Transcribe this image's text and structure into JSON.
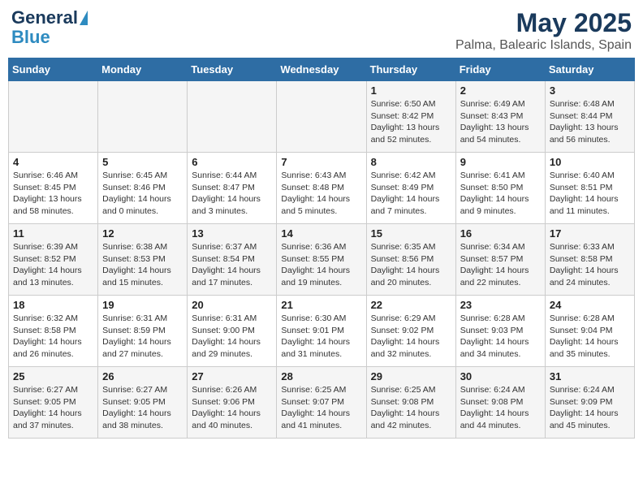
{
  "header": {
    "logo_line1": "General",
    "logo_line2": "Blue",
    "title": "May 2025",
    "subtitle": "Palma, Balearic Islands, Spain"
  },
  "days_of_week": [
    "Sunday",
    "Monday",
    "Tuesday",
    "Wednesday",
    "Thursday",
    "Friday",
    "Saturday"
  ],
  "weeks": [
    [
      {
        "day": "",
        "sunrise": "",
        "sunset": "",
        "daylight": ""
      },
      {
        "day": "",
        "sunrise": "",
        "sunset": "",
        "daylight": ""
      },
      {
        "day": "",
        "sunrise": "",
        "sunset": "",
        "daylight": ""
      },
      {
        "day": "",
        "sunrise": "",
        "sunset": "",
        "daylight": ""
      },
      {
        "day": "1",
        "sunrise": "Sunrise: 6:50 AM",
        "sunset": "Sunset: 8:42 PM",
        "daylight": "Daylight: 13 hours and 52 minutes."
      },
      {
        "day": "2",
        "sunrise": "Sunrise: 6:49 AM",
        "sunset": "Sunset: 8:43 PM",
        "daylight": "Daylight: 13 hours and 54 minutes."
      },
      {
        "day": "3",
        "sunrise": "Sunrise: 6:48 AM",
        "sunset": "Sunset: 8:44 PM",
        "daylight": "Daylight: 13 hours and 56 minutes."
      }
    ],
    [
      {
        "day": "4",
        "sunrise": "Sunrise: 6:46 AM",
        "sunset": "Sunset: 8:45 PM",
        "daylight": "Daylight: 13 hours and 58 minutes."
      },
      {
        "day": "5",
        "sunrise": "Sunrise: 6:45 AM",
        "sunset": "Sunset: 8:46 PM",
        "daylight": "Daylight: 14 hours and 0 minutes."
      },
      {
        "day": "6",
        "sunrise": "Sunrise: 6:44 AM",
        "sunset": "Sunset: 8:47 PM",
        "daylight": "Daylight: 14 hours and 3 minutes."
      },
      {
        "day": "7",
        "sunrise": "Sunrise: 6:43 AM",
        "sunset": "Sunset: 8:48 PM",
        "daylight": "Daylight: 14 hours and 5 minutes."
      },
      {
        "day": "8",
        "sunrise": "Sunrise: 6:42 AM",
        "sunset": "Sunset: 8:49 PM",
        "daylight": "Daylight: 14 hours and 7 minutes."
      },
      {
        "day": "9",
        "sunrise": "Sunrise: 6:41 AM",
        "sunset": "Sunset: 8:50 PM",
        "daylight": "Daylight: 14 hours and 9 minutes."
      },
      {
        "day": "10",
        "sunrise": "Sunrise: 6:40 AM",
        "sunset": "Sunset: 8:51 PM",
        "daylight": "Daylight: 14 hours and 11 minutes."
      }
    ],
    [
      {
        "day": "11",
        "sunrise": "Sunrise: 6:39 AM",
        "sunset": "Sunset: 8:52 PM",
        "daylight": "Daylight: 14 hours and 13 minutes."
      },
      {
        "day": "12",
        "sunrise": "Sunrise: 6:38 AM",
        "sunset": "Sunset: 8:53 PM",
        "daylight": "Daylight: 14 hours and 15 minutes."
      },
      {
        "day": "13",
        "sunrise": "Sunrise: 6:37 AM",
        "sunset": "Sunset: 8:54 PM",
        "daylight": "Daylight: 14 hours and 17 minutes."
      },
      {
        "day": "14",
        "sunrise": "Sunrise: 6:36 AM",
        "sunset": "Sunset: 8:55 PM",
        "daylight": "Daylight: 14 hours and 19 minutes."
      },
      {
        "day": "15",
        "sunrise": "Sunrise: 6:35 AM",
        "sunset": "Sunset: 8:56 PM",
        "daylight": "Daylight: 14 hours and 20 minutes."
      },
      {
        "day": "16",
        "sunrise": "Sunrise: 6:34 AM",
        "sunset": "Sunset: 8:57 PM",
        "daylight": "Daylight: 14 hours and 22 minutes."
      },
      {
        "day": "17",
        "sunrise": "Sunrise: 6:33 AM",
        "sunset": "Sunset: 8:58 PM",
        "daylight": "Daylight: 14 hours and 24 minutes."
      }
    ],
    [
      {
        "day": "18",
        "sunrise": "Sunrise: 6:32 AM",
        "sunset": "Sunset: 8:58 PM",
        "daylight": "Daylight: 14 hours and 26 minutes."
      },
      {
        "day": "19",
        "sunrise": "Sunrise: 6:31 AM",
        "sunset": "Sunset: 8:59 PM",
        "daylight": "Daylight: 14 hours and 27 minutes."
      },
      {
        "day": "20",
        "sunrise": "Sunrise: 6:31 AM",
        "sunset": "Sunset: 9:00 PM",
        "daylight": "Daylight: 14 hours and 29 minutes."
      },
      {
        "day": "21",
        "sunrise": "Sunrise: 6:30 AM",
        "sunset": "Sunset: 9:01 PM",
        "daylight": "Daylight: 14 hours and 31 minutes."
      },
      {
        "day": "22",
        "sunrise": "Sunrise: 6:29 AM",
        "sunset": "Sunset: 9:02 PM",
        "daylight": "Daylight: 14 hours and 32 minutes."
      },
      {
        "day": "23",
        "sunrise": "Sunrise: 6:28 AM",
        "sunset": "Sunset: 9:03 PM",
        "daylight": "Daylight: 14 hours and 34 minutes."
      },
      {
        "day": "24",
        "sunrise": "Sunrise: 6:28 AM",
        "sunset": "Sunset: 9:04 PM",
        "daylight": "Daylight: 14 hours and 35 minutes."
      }
    ],
    [
      {
        "day": "25",
        "sunrise": "Sunrise: 6:27 AM",
        "sunset": "Sunset: 9:05 PM",
        "daylight": "Daylight: 14 hours and 37 minutes."
      },
      {
        "day": "26",
        "sunrise": "Sunrise: 6:27 AM",
        "sunset": "Sunset: 9:05 PM",
        "daylight": "Daylight: 14 hours and 38 minutes."
      },
      {
        "day": "27",
        "sunrise": "Sunrise: 6:26 AM",
        "sunset": "Sunset: 9:06 PM",
        "daylight": "Daylight: 14 hours and 40 minutes."
      },
      {
        "day": "28",
        "sunrise": "Sunrise: 6:25 AM",
        "sunset": "Sunset: 9:07 PM",
        "daylight": "Daylight: 14 hours and 41 minutes."
      },
      {
        "day": "29",
        "sunrise": "Sunrise: 6:25 AM",
        "sunset": "Sunset: 9:08 PM",
        "daylight": "Daylight: 14 hours and 42 minutes."
      },
      {
        "day": "30",
        "sunrise": "Sunrise: 6:24 AM",
        "sunset": "Sunset: 9:08 PM",
        "daylight": "Daylight: 14 hours and 44 minutes."
      },
      {
        "day": "31",
        "sunrise": "Sunrise: 6:24 AM",
        "sunset": "Sunset: 9:09 PM",
        "daylight": "Daylight: 14 hours and 45 minutes."
      }
    ]
  ]
}
